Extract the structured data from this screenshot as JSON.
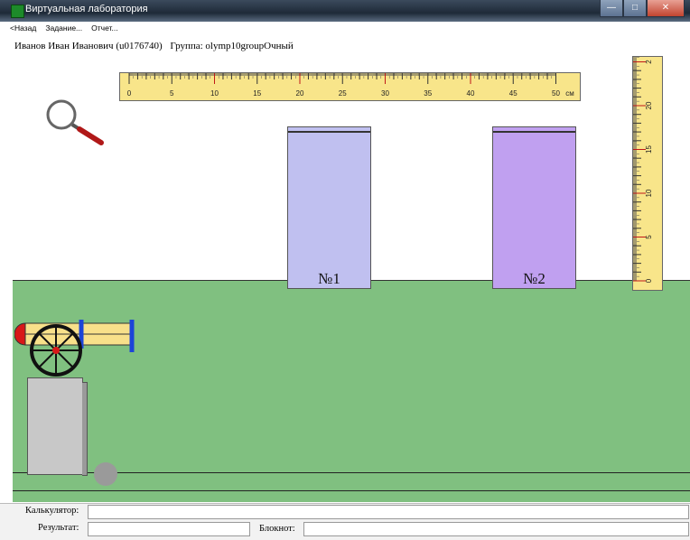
{
  "window": {
    "title": "Виртуальная лаборатория",
    "minimize_glyph": "—",
    "maximize_glyph": "□",
    "close_glyph": "✕"
  },
  "menu": [
    "<Назад",
    "Задание...",
    "Отчет..."
  ],
  "user": {
    "name": "Иванов Иван Иванович (u0176740)",
    "group": "Группа: olymp10groupОчный"
  },
  "ruler_horizontal": {
    "labels": [
      "0",
      "5",
      "10",
      "15",
      "20",
      "25",
      "30",
      "35",
      "40",
      "45",
      "50"
    ],
    "unit": "см"
  },
  "ruler_vertical": {
    "labels": [
      "0",
      "5",
      "10",
      "15",
      "20",
      "2"
    ]
  },
  "cylinders": [
    {
      "label": "№1",
      "color": "#c0c0f0"
    },
    {
      "label": "№2",
      "color": "#c0a0f0"
    }
  ],
  "colors": {
    "ground": "#80c080",
    "ruler": "#f8e58a",
    "cannon_barrel": "#f8e08a",
    "cannon_band": "#1c44d8",
    "cannon_tip": "#d81818",
    "magnifier_handle": "#b01818"
  },
  "icons": [
    "magnifier-icon",
    "cannon-icon",
    "ball-icon"
  ],
  "bottom": {
    "calculator_label": "Калькулятор:",
    "result_label": "Результат:",
    "notepad_label": "Блокнот:"
  }
}
